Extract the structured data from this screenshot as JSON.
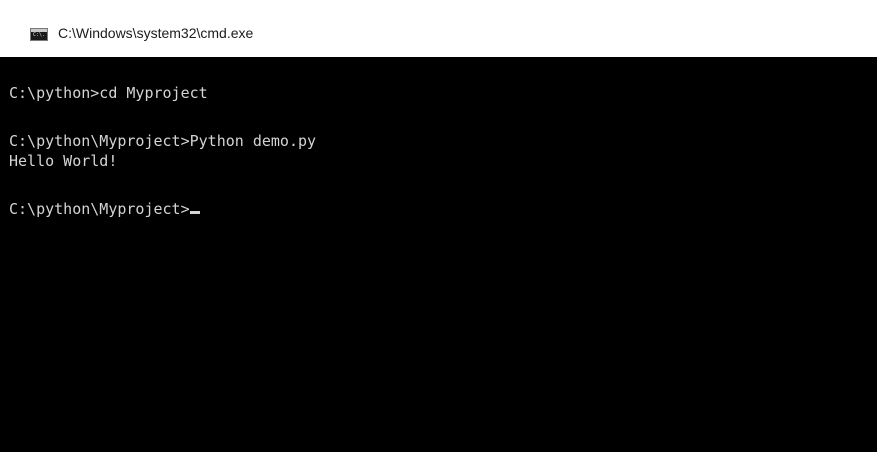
{
  "window": {
    "title": "C:\\Windows\\system32\\cmd.exe",
    "icon": "cmd-console-icon",
    "icon_glyph": "C:\\."
  },
  "console": {
    "background_color": "#000000",
    "text_color": "#d4d4d4",
    "lines": [
      "C:\\python>cd Myproject",
      "C:\\python\\Myproject>Python demo.py",
      "Hello World!",
      "C:\\python\\Myproject>"
    ]
  }
}
